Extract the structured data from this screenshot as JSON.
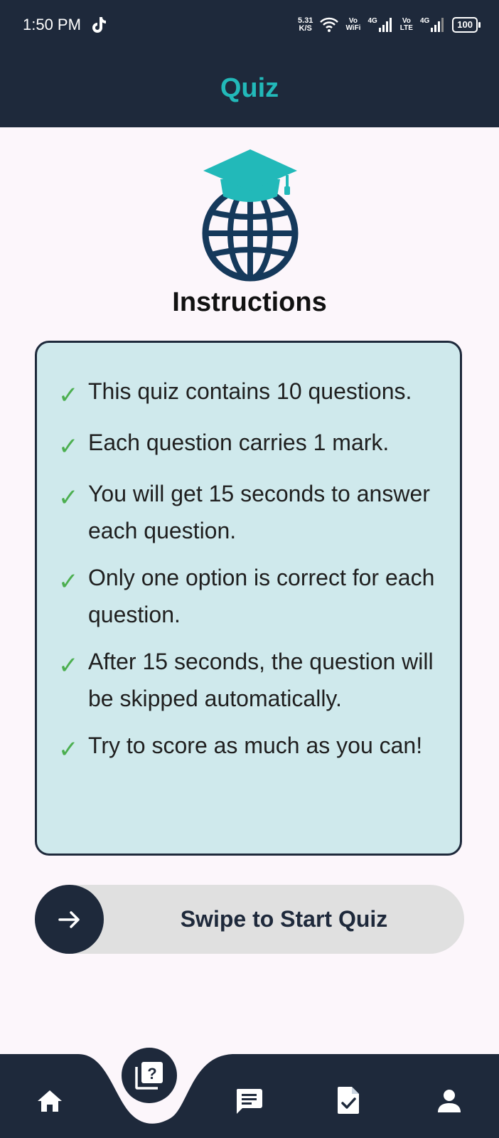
{
  "status_bar": {
    "time": "1:50 PM",
    "net_speed_value": "5.31",
    "net_speed_unit": "K/S",
    "vo_wifi_top": "Vo",
    "vo_wifi_bottom": "WiFi",
    "sig1_label": "4G",
    "vo_lte_top": "Vo",
    "vo_lte_bottom": "LTE",
    "sig2_label": "4G",
    "battery": "100"
  },
  "app_bar": {
    "title": "Quiz"
  },
  "heading": "Instructions",
  "instructions": [
    "This quiz contains 10 questions.",
    "Each question carries 1 mark.",
    "You will get 15 seconds to answer each question.",
    "Only one option is correct for each question.",
    "After 15 seconds, the question will be skipped automatically.",
    "Try to score as much as you can!"
  ],
  "check_glyph": "✓",
  "swipe": {
    "label": "Swipe to Start Quiz"
  },
  "nav": {
    "items": [
      "home-icon",
      "quiz-icon",
      "chat-icon",
      "assignment-icon",
      "person-icon"
    ],
    "active": "quiz"
  },
  "colors": {
    "dark": "#1e293b",
    "accent": "#22b9b9",
    "card": "#cfe9ec",
    "check": "#4caf50",
    "background": "#fcf6fb"
  }
}
